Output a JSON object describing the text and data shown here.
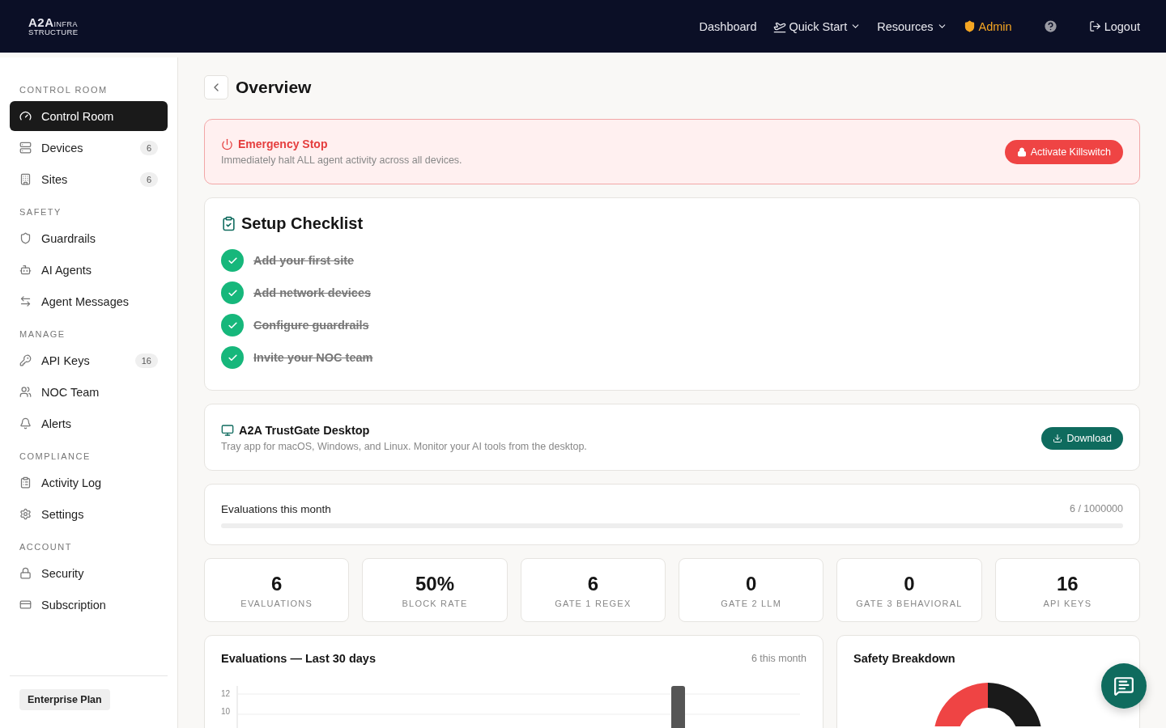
{
  "logo": {
    "main": "A2A",
    "super": "INFRA",
    "sub": "STRUCTURE"
  },
  "nav": [
    {
      "label": "Dashboard",
      "kind": "link"
    },
    {
      "label": "Quick Start",
      "kind": "icon_dropdown"
    },
    {
      "label": "Resources",
      "kind": "dropdown"
    },
    {
      "label": "Admin",
      "kind": "admin"
    },
    {
      "kind": "help"
    },
    {
      "label": "Logout",
      "kind": "logout"
    }
  ],
  "sidebar": {
    "sections": [
      {
        "title": "CONTROL ROOM",
        "items": [
          {
            "label": "Control Room",
            "selected": true
          },
          {
            "label": "Devices",
            "selected": false,
            "badge": "6"
          },
          {
            "label": "Sites",
            "selected": false,
            "badge": "6"
          }
        ]
      },
      {
        "title": "SAFETY",
        "items": [
          {
            "label": "Guardrails",
            "selected": false
          },
          {
            "label": "AI Agents",
            "selected": false
          },
          {
            "label": "Agent Messages",
            "selected": false
          }
        ]
      },
      {
        "title": "MANAGE",
        "items": [
          {
            "label": "API Keys",
            "selected": false,
            "badge": "16"
          },
          {
            "label": "NOC Team",
            "selected": false
          },
          {
            "label": "Alerts",
            "selected": false
          }
        ]
      },
      {
        "title": "COMPLIANCE",
        "items": [
          {
            "label": "Activity Log",
            "selected": false
          },
          {
            "label": "Settings",
            "selected": false
          }
        ]
      },
      {
        "title": "ACCOUNT",
        "items": [
          {
            "label": "Security",
            "selected": false
          },
          {
            "label": "Subscription",
            "selected": false
          }
        ]
      }
    ],
    "plan": "Enterprise Plan"
  },
  "page_title": "Overview",
  "emergency": {
    "title": "Emergency Stop",
    "text": "Immediately halt ALL agent activity across all devices.",
    "button": "Activate Killswitch"
  },
  "checklist": {
    "title": "Setup Checklist",
    "items": [
      {
        "label": "Add your first site",
        "checked": true
      },
      {
        "label": "Add network devices",
        "checked": true
      },
      {
        "label": "Configure guardrails",
        "checked": true
      },
      {
        "label": "Invite your NOC team",
        "checked": true
      }
    ]
  },
  "desktop": {
    "title": "A2A TrustGate Desktop",
    "text": "Tray app for macOS, Windows, and Linux. Monitor your AI tools from the desktop.",
    "button": "Download"
  },
  "usage": {
    "label": "Evaluations this month",
    "reading": "6 / 1000000"
  },
  "stats": [
    {
      "value": "6",
      "label": "EVALUATIONS"
    },
    {
      "value": "50%",
      "label": "BLOCK RATE"
    },
    {
      "value": "6",
      "label": "GATE 1 REGEX"
    },
    {
      "value": "0",
      "label": "GATE 2 LLM"
    },
    {
      "value": "0",
      "label": "GATE 3 BEHAVIORAL"
    },
    {
      "value": "16",
      "label": "API KEYS"
    }
  ],
  "evaluations_chart": {
    "title": "Evaluations — Last 30 days",
    "note": "6 this month",
    "tick_labels": [
      "12",
      "10"
    ]
  },
  "safety_breakdown": {
    "title": "Safety Breakdown"
  }
}
